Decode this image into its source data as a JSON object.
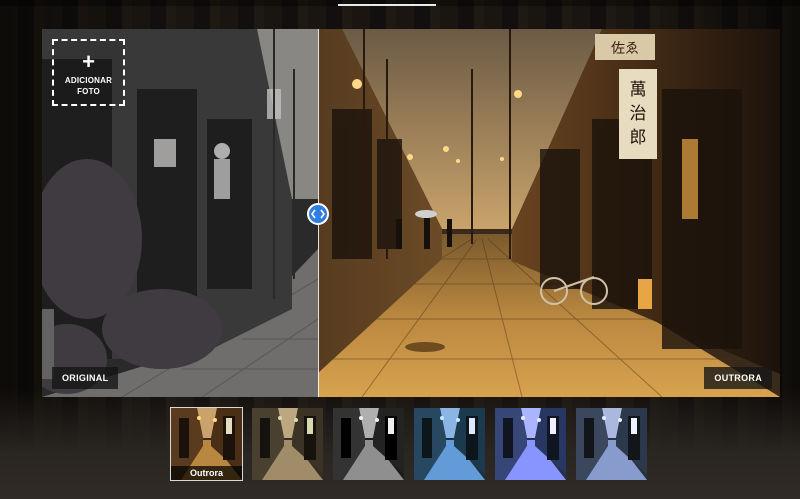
{
  "editor": {
    "add_photo": {
      "icon": "plus-icon",
      "plus": "+",
      "label_line1": "ADICIONAR",
      "label_line2": "FOTO"
    },
    "labels": {
      "before": "ORIGINAL",
      "after": "OUTRORA"
    },
    "compare": {
      "handle_icon": "left-right-arrows-icon",
      "accent_color": "#2f7fe0"
    },
    "filters": [
      {
        "id": "outrora",
        "caption": "Outrora",
        "selected": true
      },
      {
        "id": "sepia",
        "caption": "",
        "selected": false
      },
      {
        "id": "bw",
        "caption": "",
        "selected": false
      },
      {
        "id": "teal",
        "caption": "",
        "selected": false
      },
      {
        "id": "blue",
        "caption": "",
        "selected": false
      },
      {
        "id": "cool",
        "caption": "",
        "selected": false
      }
    ]
  },
  "scene_signs": {
    "top_sign": "佐ゑ",
    "vertical_sign": "萬治郎"
  }
}
